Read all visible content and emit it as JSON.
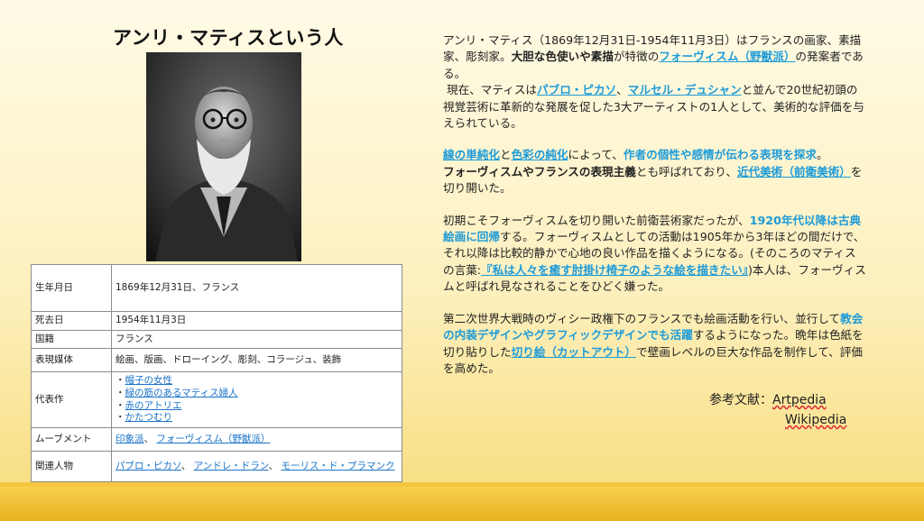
{
  "title": "アンリ・マティスという人",
  "info": {
    "born_label": "生年月日",
    "born_value": "1869年12月31日、フランス",
    "died_label": "死去日",
    "died_value": "1954年11月3日",
    "nationality_label": "国籍",
    "nationality_value": "フランス",
    "media_label": "表現媒体",
    "media_value": "絵画、版画、ドローイング、彫刻、コラージュ、装飾",
    "works_label": "代表作",
    "works": [
      "帽子の女性",
      "緑の筋のあるマティス婦人",
      "赤のアトリエ",
      "かたつむり"
    ],
    "movement_label": "ムーブメント",
    "movements": [
      "印象派",
      "フォーヴィスム（野獣派）"
    ],
    "related_label": "関連人物",
    "related": [
      "パブロ・ピカソ",
      "アンドレ・ドラン",
      "モーリス・ド・ブラマンク"
    ]
  },
  "article": {
    "p1": {
      "t1": "アンリ・マティス（1869年12月31日-1954年11月3日）はフランスの画家、素描家、彫刻家。",
      "b1": "大胆な色使いや素描",
      "t2": "が特徴の",
      "l1": "フォーヴィスム（野獣派）",
      "t3": "の発案者である。",
      "t4": "現在、マティスは",
      "l2": "パブロ・ピカソ",
      "t5": "、",
      "l3": "マルセル・デュシャン",
      "t6": "と並んで20世紀初頭の視覚芸術に革新的な発展を促した3大アーティストの1人として、美術的な評価を与えられている。"
    },
    "p2": {
      "l1": "線の単純化",
      "t1": "と",
      "l2": "色彩の純化",
      "t2": "によって、",
      "h1": "作者の個性や感情が伝わる表現を探求",
      "t3": "。",
      "b1": "フォーヴィスムやフランスの表現主義",
      "t4": "とも呼ばれており、",
      "l3": "近代美術（前衛美術）",
      "t5": "を切り開いた。"
    },
    "p3": {
      "t1": "初期こそフォーヴィスムを切り開いた前衛芸術家だったが、",
      "h1": "1920年代以降は古典絵画に回帰",
      "t2": "する。フォーヴィスムとしての活動は1905年から3年ほどの間だけで、それ以降は比較的静かで心地の良い作品を描くようになる。(そのころのマティスの言葉:",
      "l1": "『私は人々を癒す肘掛け椅子のような絵を描きたい』",
      "t3": ")本人は、フォーヴィスムと呼ばれ見なされることをひどく嫌った。"
    },
    "p4": {
      "t1": "第二次世界大戦時のヴィシー政権下のフランスでも絵画活動を行い、並行して",
      "h1": "教会の内装デザインやグラフィックデザインでも活躍",
      "t2": "するようになった。晩年は色紙を切り貼りした",
      "l1": "切り絵（カットアウト）",
      "t3": "で壁画レベルの巨大な作品を制作して、評価を高めた。"
    }
  },
  "refs": {
    "label": "参考文献：",
    "items": [
      "Artpedia",
      "Wikipedia"
    ]
  },
  "colors": {
    "highlight": "#1d9bd8",
    "table_link": "#1a73c8",
    "band": "#f0be2e"
  }
}
